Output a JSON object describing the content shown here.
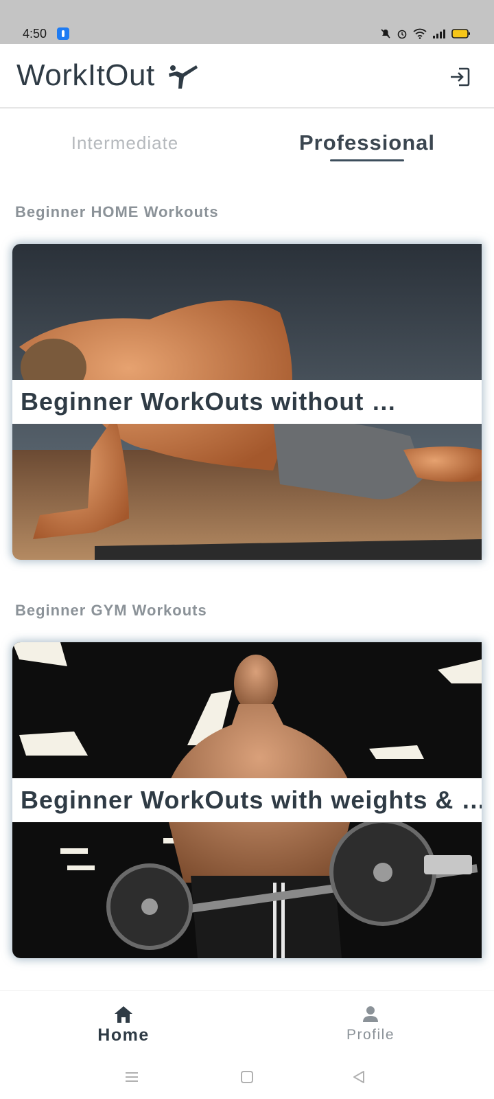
{
  "status_bar": {
    "time": "4:50"
  },
  "app_bar": {
    "title": "WorkItOut",
    "logo_icon": "martial-arts-kick-icon",
    "action_icon": "login-icon"
  },
  "tabs": [
    {
      "label": "Intermediate",
      "selected": false
    },
    {
      "label": "Professional",
      "selected": true
    }
  ],
  "sections": [
    {
      "title": "Beginner HOME Workouts",
      "card_title": "Beginner WorkOuts without …"
    },
    {
      "title": "Beginner GYM Workouts",
      "card_title": "Beginner WorkOuts with weights & …"
    }
  ],
  "bottom_nav": {
    "items": [
      {
        "label": "Home",
        "icon": "home-icon",
        "active": true
      },
      {
        "label": "Profile",
        "icon": "person-icon",
        "active": false
      }
    ]
  },
  "colors": {
    "primary_text": "#2f3b45",
    "muted_text": "#8b9298",
    "status_bar": "#c4c4c4",
    "card_glow": "#7896aa"
  }
}
